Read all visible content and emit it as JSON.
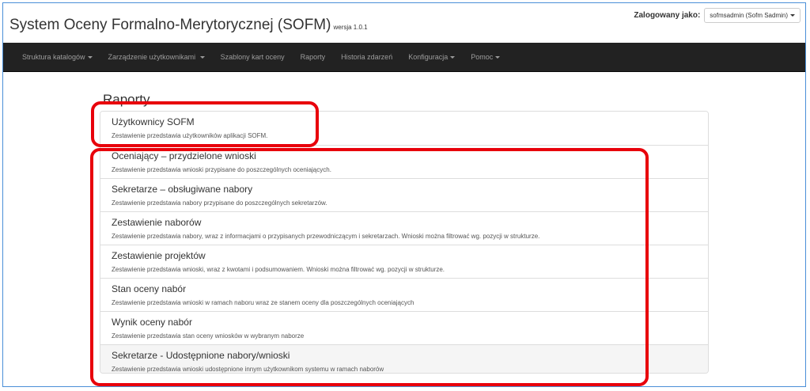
{
  "header": {
    "title": "System Oceny Formalno-Merytorycznej (SOFM)",
    "version": "wersja 1.0.1",
    "login_label": "Zalogowany jako:",
    "user": "sofmsadmin (Sofm Sadmin)"
  },
  "nav": {
    "items": [
      {
        "label": "Struktura katalogów"
      },
      {
        "label": "Zarządzenie użytkownikami"
      },
      {
        "label": "Szablony kart oceny"
      },
      {
        "label": "Raporty"
      },
      {
        "label": "Historia zdarzeń"
      },
      {
        "label": "Konfiguracja"
      },
      {
        "label": "Pomoc"
      }
    ]
  },
  "page": {
    "title": "Raporty",
    "reports": [
      {
        "title": "Użytkownicy SOFM",
        "desc": "Zestawienie przedstawia użytkowników aplikacji SOFM."
      },
      {
        "title": "Oceniający – przydzielone wnioski",
        "desc": "Zestawienie przedstawia wnioski przypisane do poszczególnych oceniających."
      },
      {
        "title": "Sekretarze – obsługiwane nabory",
        "desc": "Zestawienie przedstawia nabory przypisane do poszczególnych sekretarzów."
      },
      {
        "title": "Zestawienie naborów",
        "desc": "Zestawienie przedstawia nabory, wraz z informacjami o przypisanych przewodniczącym i sekretarzach. Wnioski można filtrować wg. pozycji w strukturze."
      },
      {
        "title": "Zestawienie projektów",
        "desc": "Zestawienie przedstawia wnioski, wraz z kwotami i podsumowaniem. Wnioski można filtrować wg. pozycji w strukturze."
      },
      {
        "title": "Stan oceny nabór",
        "desc": "Zestawienie przedstawia wnioski w ramach naboru wraz ze stanem oceny dla poszczególnych oceniających"
      },
      {
        "title": "Wynik oceny nabór",
        "desc": "Zestawienie przedstawia stan oceny wniosków w wybranym naborze"
      },
      {
        "title": "Sekretarze - Udostępnione nabory/wnioski",
        "desc": "Zestawienie przedstawia wnioski udostępnione innym użytkownikom systemu w ramach naborów"
      }
    ]
  },
  "colors": {
    "navbar_bg": "#222222",
    "nav_text": "#9d9d9d",
    "highlight": "#e8000b",
    "frame_border": "#4a8fd8"
  }
}
